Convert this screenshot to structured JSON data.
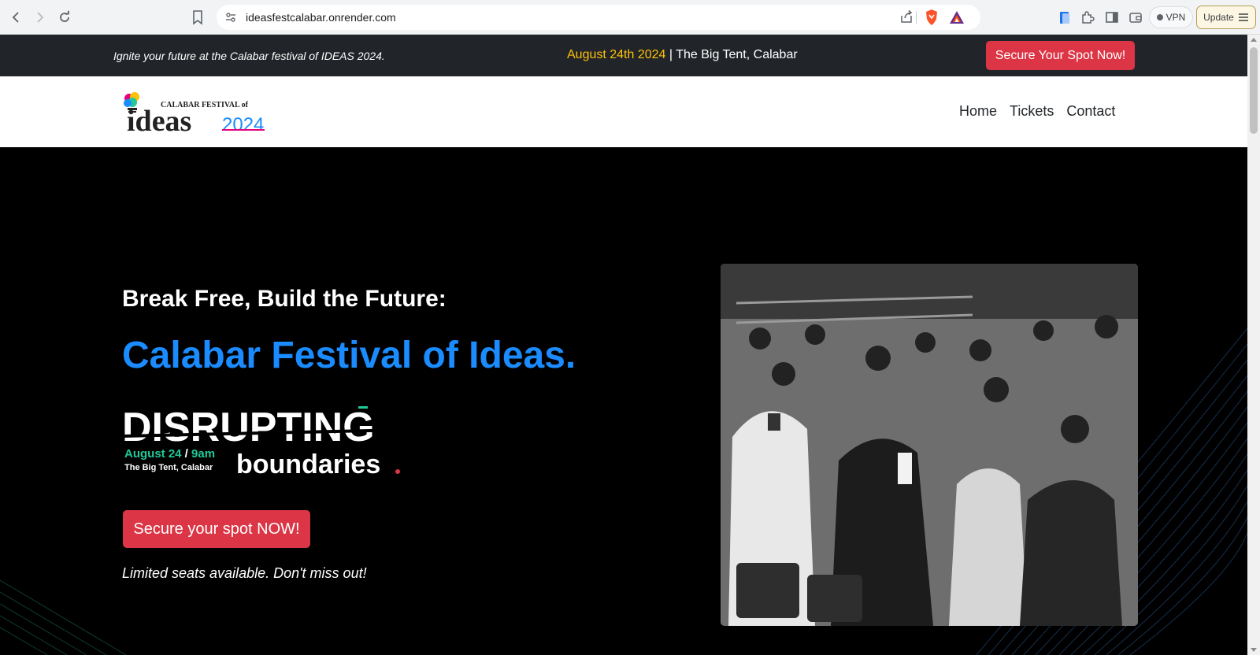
{
  "browser": {
    "url": "ideasfestcalabar.onrender.com",
    "vpn_label": "VPN",
    "update_label": "Update"
  },
  "topbar": {
    "tagline": "Ignite your future at the Calabar festival of IDEAS 2024.",
    "event_date": "August 24th 2024",
    "event_sep": " | ",
    "event_venue": "The Big Tent, Calabar",
    "cta_label": "Secure Your Spot Now!"
  },
  "navbar": {
    "logo": {
      "small_text": "CALABAR FESTIVAL of",
      "big_text": "ideas",
      "year": "2024"
    },
    "links": [
      "Home",
      "Tickets",
      "Contact"
    ]
  },
  "hero": {
    "subtitle": "Break Free, Build the Future:",
    "title": "Calabar Festival of Ideas.",
    "theme_word_1": "DISRUPTING",
    "theme_word_2": "boundaries",
    "theme_date": "August 24",
    "theme_sep": " / ",
    "theme_time": "9am",
    "theme_venue": "The Big Tent, Calabar",
    "cta_label": "Secure your spot NOW!",
    "note": "Limited seats available. Don't miss out!"
  },
  "colors": {
    "topbar_bg": "#212529",
    "accent_red": "#dc3545",
    "accent_yellow": "#ffc107",
    "title_blue": "#1a8cff",
    "teal": "#20c997"
  }
}
